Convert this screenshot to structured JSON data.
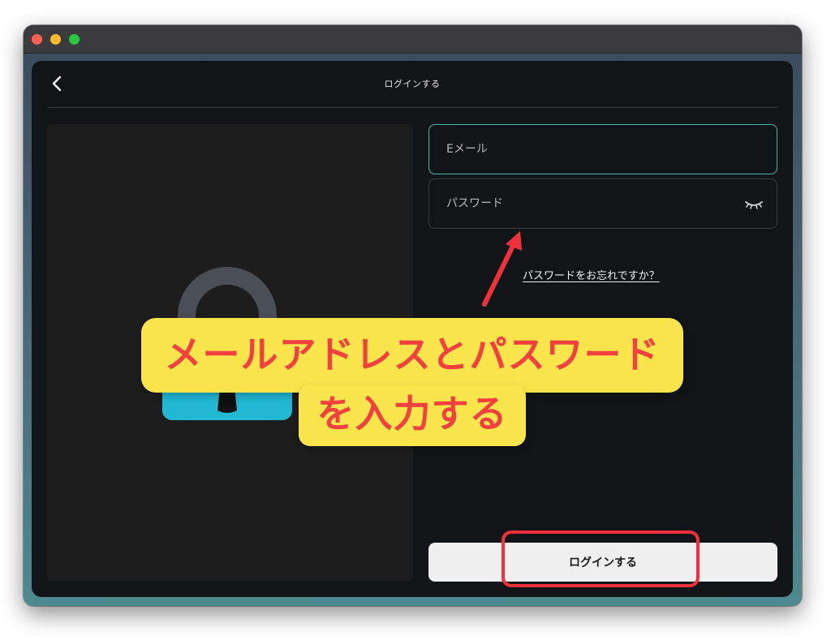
{
  "window": {
    "traffic_lights": [
      "close",
      "minimize",
      "zoom"
    ]
  },
  "header": {
    "back_icon": "chevron-left-icon",
    "title": "ログインする"
  },
  "illustration": {
    "icon": "padlock-icon",
    "colors": {
      "shackle": "#4a4f55",
      "body": "#22b8d4",
      "keyhole": "#111111"
    }
  },
  "form": {
    "email": {
      "placeholder": "Eメール",
      "value": ""
    },
    "password": {
      "placeholder": "パスワード",
      "value": "",
      "toggle_icon": "eye-closed-icon"
    },
    "forgot_link": "パスワードをお忘れですか？",
    "login_button": "ログインする"
  },
  "annotation": {
    "callout_line1": "メールアドレスとパスワード",
    "callout_line2": "を入力する",
    "colors": {
      "callout_bg": "#fbe54d",
      "callout_text": "#f04040",
      "highlight": "#f0303a"
    }
  },
  "colors": {
    "app_bg": "#121517",
    "accent": "#3fb8b0",
    "button_bg": "#efefef"
  }
}
